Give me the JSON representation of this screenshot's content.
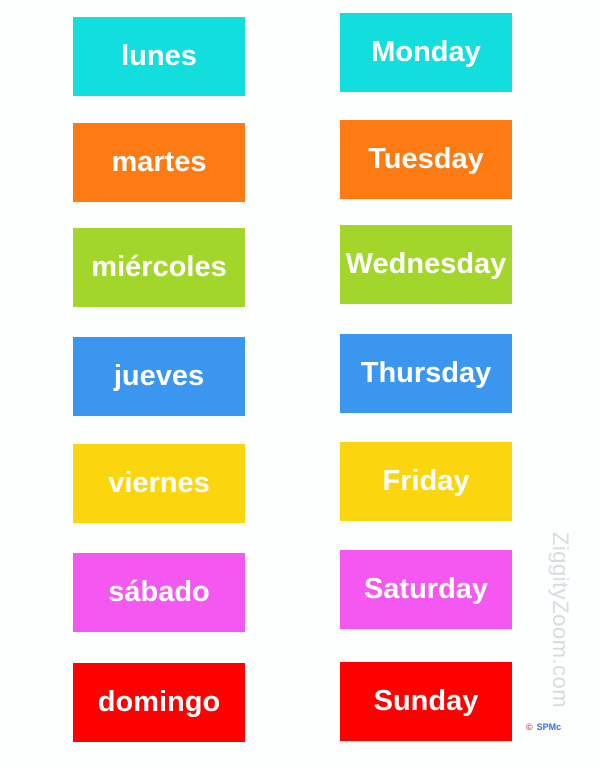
{
  "cards": [
    {
      "spanish": "lunes",
      "english": "Monday",
      "color": "#12dede"
    },
    {
      "spanish": "martes",
      "english": "Tuesday",
      "color": "#fd7b12"
    },
    {
      "spanish": "miércoles",
      "english": "Wednesday",
      "color": "#a3d62a"
    },
    {
      "spanish": "jueves",
      "english": "Thursday",
      "color": "#3a96ee"
    },
    {
      "spanish": "viernes",
      "english": "Friday",
      "color": "#fbd60f"
    },
    {
      "spanish": "sábado",
      "english": "Saturday",
      "color": "#f458f0"
    },
    {
      "spanish": "domingo",
      "english": "Sunday",
      "color": "#fe0000"
    }
  ],
  "watermark": "ZiggityZoom.com",
  "copyright": {
    "symbol": "©",
    "text": "SPMc"
  }
}
